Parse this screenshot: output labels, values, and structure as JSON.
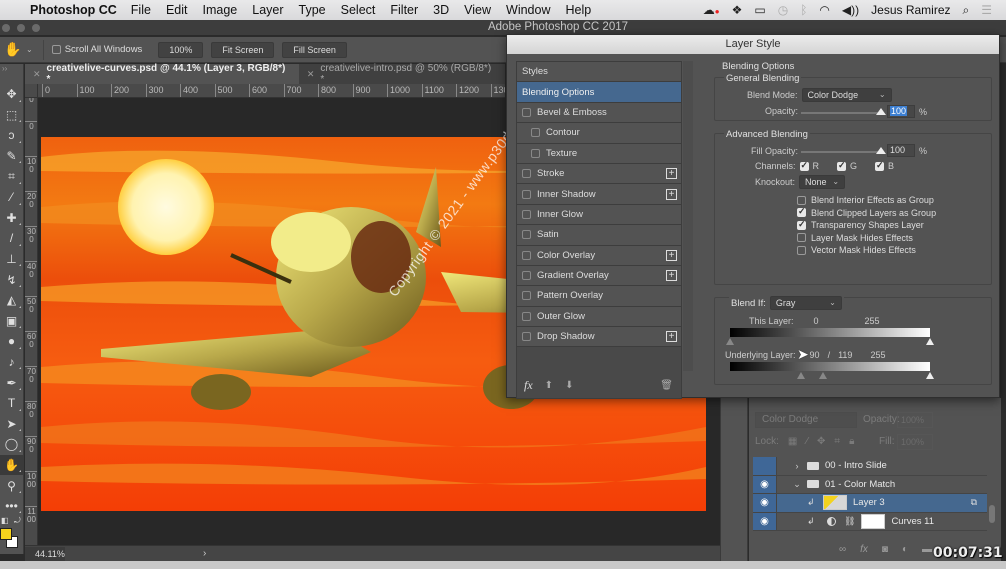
{
  "menubar": {
    "apple": "",
    "app_name": "Photoshop CC",
    "menus": [
      "File",
      "Edit",
      "Image",
      "Layer",
      "Type",
      "Select",
      "Filter",
      "3D",
      "View",
      "Window",
      "Help"
    ],
    "user": "Jesus Ramirez",
    "tray_icons": [
      "creative-cloud-icon",
      "dropbox-icon",
      "airplay-icon",
      "time-machine-icon",
      "bluetooth-icon",
      "wifi-icon",
      "volume-icon"
    ],
    "search_glyph": "⌕",
    "list_glyph": "☰"
  },
  "window": {
    "title": "Adobe Photoshop CC 2017"
  },
  "options_bar": {
    "tool_glyph": "✋",
    "scroll_all_windows": {
      "label": "Scroll All Windows",
      "checked": false
    },
    "zoom_button": "100%",
    "fit_screen": "Fit Screen",
    "fill_screen": "Fill Screen"
  },
  "tabs": [
    {
      "label": "creativelive-curves.psd @ 44.1% (Layer 3, RGB/8*) *",
      "active": true
    },
    {
      "label": "creativelive-intro.psd @ 50% (RGB/8*) *",
      "active": false
    }
  ],
  "rulers": {
    "horizontal": [
      "0",
      "100",
      "200",
      "300",
      "400",
      "500",
      "600",
      "700",
      "800",
      "900",
      "1000",
      "1100",
      "1200",
      "130"
    ],
    "vertical": [
      "100",
      "0",
      "100",
      "200",
      "300",
      "400",
      "500",
      "600",
      "700",
      "800",
      "900",
      "1000",
      "1100"
    ]
  },
  "tools": [
    {
      "name": "move",
      "glyph": "✥"
    },
    {
      "name": "marquee",
      "glyph": "⬚"
    },
    {
      "name": "lasso",
      "glyph": "ↄ"
    },
    {
      "name": "quick-select",
      "glyph": "✎"
    },
    {
      "name": "crop",
      "glyph": "⌗"
    },
    {
      "name": "eyedropper",
      "glyph": "⁄"
    },
    {
      "name": "healing",
      "glyph": "✚"
    },
    {
      "name": "brush",
      "glyph": "/"
    },
    {
      "name": "stamp",
      "glyph": "⊥"
    },
    {
      "name": "history-brush",
      "glyph": "↯"
    },
    {
      "name": "eraser",
      "glyph": "◭"
    },
    {
      "name": "gradient",
      "glyph": "▣"
    },
    {
      "name": "blur",
      "glyph": "●"
    },
    {
      "name": "dodge",
      "glyph": "♪"
    },
    {
      "name": "pen",
      "glyph": "✒"
    },
    {
      "name": "type",
      "glyph": "T"
    },
    {
      "name": "path-select",
      "glyph": "➤"
    },
    {
      "name": "ellipse",
      "glyph": "◯"
    },
    {
      "name": "hand",
      "glyph": "✋",
      "active": true
    },
    {
      "name": "zoom",
      "glyph": "⚲"
    },
    {
      "name": "more",
      "glyph": "•••"
    }
  ],
  "colors": {
    "foreground": "#f6d31d",
    "background": "#ffffff"
  },
  "canvas": {
    "watermark": "Copyright © 2021 - www.p30download.com"
  },
  "status": {
    "zoom": "44.11%",
    "arrow": "›"
  },
  "dialog": {
    "title": "Layer Style",
    "styles_header": "Styles",
    "style_items": [
      {
        "label": "Blending Options",
        "selected": true,
        "checkbox": false,
        "plus": false,
        "sub": false
      },
      {
        "label": "Bevel & Emboss",
        "checkbox": true,
        "checked": false,
        "plus": false,
        "sub": false
      },
      {
        "label": "Contour",
        "checkbox": true,
        "checked": false,
        "plus": false,
        "sub": true
      },
      {
        "label": "Texture",
        "checkbox": true,
        "checked": false,
        "plus": false,
        "sub": true
      },
      {
        "label": "Stroke",
        "checkbox": true,
        "checked": false,
        "plus": true,
        "sub": false
      },
      {
        "label": "Inner Shadow",
        "checkbox": true,
        "checked": false,
        "plus": true,
        "sub": false
      },
      {
        "label": "Inner Glow",
        "checkbox": true,
        "checked": false,
        "plus": false,
        "sub": false
      },
      {
        "label": "Satin",
        "checkbox": true,
        "checked": false,
        "plus": false,
        "sub": false
      },
      {
        "label": "Color Overlay",
        "checkbox": true,
        "checked": false,
        "plus": true,
        "sub": false
      },
      {
        "label": "Gradient Overlay",
        "checkbox": true,
        "checked": false,
        "plus": true,
        "sub": false
      },
      {
        "label": "Pattern Overlay",
        "checkbox": true,
        "checked": false,
        "plus": false,
        "sub": false
      },
      {
        "label": "Outer Glow",
        "checkbox": true,
        "checked": false,
        "plus": false,
        "sub": false
      },
      {
        "label": "Drop Shadow",
        "checkbox": true,
        "checked": false,
        "plus": true,
        "sub": false
      }
    ],
    "footer": {
      "fx": "fx",
      "up": "⬆",
      "down": "⬇",
      "trash": "🗑"
    },
    "blending": {
      "section_title": "Blending Options",
      "general": {
        "legend": "General Blending",
        "blend_mode_label": "Blend Mode:",
        "blend_mode": "Color Dodge",
        "opacity_label": "Opacity:",
        "opacity": "100",
        "opacity_pct": 100,
        "unit": "%"
      },
      "advanced": {
        "legend": "Advanced Blending",
        "fill_opacity_label": "Fill Opacity:",
        "fill_opacity": "100",
        "fill_opacity_pct": 100,
        "unit": "%",
        "channels_label": "Channels:",
        "channels": [
          {
            "label": "R",
            "checked": true
          },
          {
            "label": "G",
            "checked": true
          },
          {
            "label": "B",
            "checked": true
          }
        ],
        "knockout_label": "Knockout:",
        "knockout": "None",
        "options": [
          {
            "label": "Blend Interior Effects as Group",
            "checked": false
          },
          {
            "label": "Blend Clipped Layers as Group",
            "checked": true
          },
          {
            "label": "Transparency Shapes Layer",
            "checked": true
          },
          {
            "label": "Layer Mask Hides Effects",
            "checked": false
          },
          {
            "label": "Vector Mask Hides Effects",
            "checked": false
          }
        ]
      },
      "blend_if": {
        "label": "Blend If:",
        "channel": "Gray",
        "this_layer_label": "This Layer:",
        "this_layer_low": "0",
        "this_layer_high": "255",
        "underlying_label": "Underlying Layer:",
        "underlying_low": "90",
        "underlying_sep": "/",
        "underlying_low2": "119",
        "underlying_high": "255",
        "this_layer_values": [
          0,
          255
        ],
        "underlying_values": [
          90,
          119,
          255
        ]
      }
    }
  },
  "layers_panel": {
    "blend_mode": "Color Dodge",
    "opacity_label": "Opacity:",
    "opacity": "100%",
    "lock_label": "Lock:",
    "fill_label": "Fill:",
    "fill": "100%",
    "layers": [
      {
        "name": "00 - Intro Slide",
        "type": "group",
        "visible": false,
        "expanded": false
      },
      {
        "name": "01 - Color Match",
        "type": "group",
        "visible": true,
        "expanded": true
      },
      {
        "name": "Layer 3",
        "type": "pixel",
        "visible": true,
        "selected": true,
        "clipped": true
      },
      {
        "name": "Curves 11",
        "type": "adjustment",
        "visible": true,
        "clipped": true
      }
    ]
  },
  "video": {
    "timecode": "00:07:31"
  }
}
